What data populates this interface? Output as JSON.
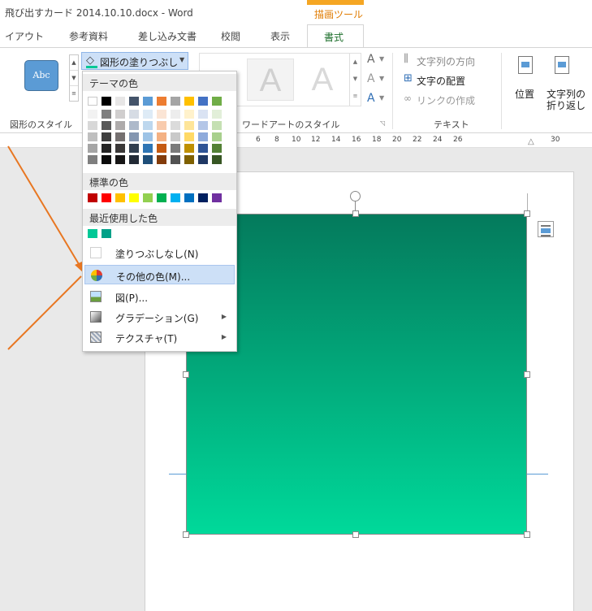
{
  "title": "飛び出すカード 2014.10.10.docx - Word",
  "context_tab_group": "描画ツール",
  "tabs": [
    "イアウト",
    "参考資料",
    "差し込み文書",
    "校閲",
    "表示",
    "書式"
  ],
  "active_tab": "書式",
  "ribbon": {
    "shape_style_sample": "Abc",
    "shape_fill_button": "図形の塗りつぶし",
    "wordart_letter": "A",
    "text_direction": "文字列の方向",
    "text_align": "文字の配置",
    "create_link": "リンクの作成",
    "position_label": "位置",
    "wrap_line1": "文字列の",
    "wrap_line2": "折り返し",
    "group_shape_styles": "図形のスタイル",
    "group_wordart": "ワードアートのスタイル",
    "group_text": "テキスト"
  },
  "ruler_ticks": [
    "6",
    "8",
    "10",
    "12",
    "14",
    "16",
    "18",
    "20",
    "22",
    "24",
    "26",
    "30"
  ],
  "dropdown": {
    "theme_colors_header": "テーマの色",
    "standard_colors_header": "標準の色",
    "recent_colors_header": "最近使用した色",
    "no_fill": "塗りつぶしなし(N)",
    "more_colors": "その他の色(M)...",
    "picture": "図(P)...",
    "gradient": "グラデーション(G)",
    "texture": "テクスチャ(T)",
    "theme_top_row": [
      "#ffffff",
      "#000000",
      "#e7e6e6",
      "#44546a",
      "#5b9bd5",
      "#ed7d31",
      "#a5a5a5",
      "#ffc000",
      "#4472c4",
      "#70ad47"
    ],
    "theme_shades": [
      [
        "#f2f2f2",
        "#7f7f7f",
        "#d0cece",
        "#d6dce4",
        "#deebf6",
        "#fbe5d5",
        "#ededed",
        "#fff2cc",
        "#dae3f3",
        "#e2efd9"
      ],
      [
        "#d8d8d8",
        "#595959",
        "#aeabab",
        "#adb9ca",
        "#bdd7ee",
        "#f8cbad",
        "#dbdbdb",
        "#fee599",
        "#b4c6e7",
        "#c5e0b3"
      ],
      [
        "#bfbfbf",
        "#3f3f3f",
        "#757070",
        "#8496b0",
        "#9dc3e6",
        "#f4b183",
        "#c9c9c9",
        "#ffd965",
        "#8eaadb",
        "#a8d08d"
      ],
      [
        "#a5a5a5",
        "#262626",
        "#3a3838",
        "#323f4f",
        "#2e75b5",
        "#c55a11",
        "#7b7b7b",
        "#bf9000",
        "#2f5496",
        "#538135"
      ],
      [
        "#7f7f7f",
        "#0c0c0c",
        "#171616",
        "#222a35",
        "#1e4e79",
        "#833c0b",
        "#525252",
        "#7f6000",
        "#1f3864",
        "#375623"
      ]
    ],
    "standard_colors": [
      "#c00000",
      "#ff0000",
      "#ffc000",
      "#ffff00",
      "#92d050",
      "#00b050",
      "#00b0f0",
      "#0070c0",
      "#002060",
      "#7030a0"
    ],
    "recent_colors": [
      "#00c896",
      "#00a088"
    ]
  },
  "shape_gradient": [
    "#047a5c",
    "#00d99a"
  ],
  "colors": {
    "active_tab_text": "#1e6f2c",
    "context_group": "#f5a623",
    "menu_highlight": "#cde0f7",
    "arrow": "#e87722"
  }
}
